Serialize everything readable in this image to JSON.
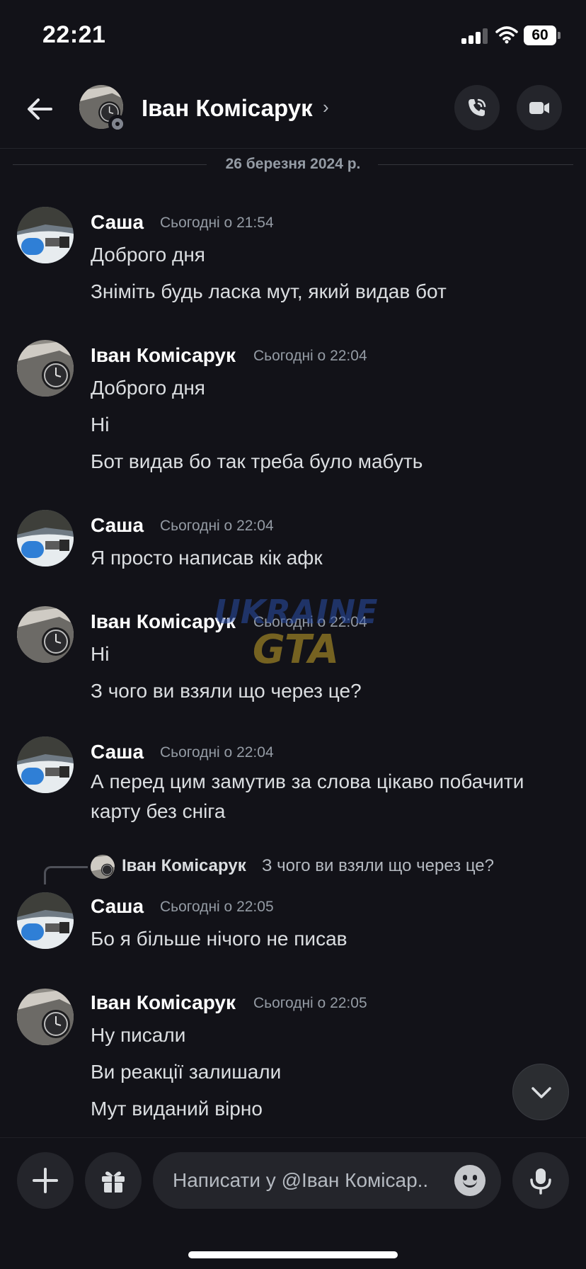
{
  "status_bar": {
    "time": "22:21",
    "battery": "60"
  },
  "header": {
    "contact_name": "Іван Комісарук",
    "chevron": "›"
  },
  "date_divider": "26 березня 2024 р.",
  "messages": [
    {
      "author": "Саша",
      "time": "Сьогодні о 21:54",
      "lines": [
        "Доброго дня",
        "Зніміть будь ласка мут, який видав бот"
      ]
    },
    {
      "author": "Іван Комісарук",
      "time": "Сьогодні о 22:04",
      "lines": [
        "Доброго дня",
        "Ні",
        "Бот видав бо так треба було мабуть"
      ]
    },
    {
      "author": "Саша",
      "time": "Сьогодні о 22:04",
      "lines": [
        "Я просто написав кік афк"
      ]
    },
    {
      "author": "Іван Комісарук",
      "time": "Сьогодні о 22:04",
      "lines": [
        "Ні",
        "З чого ви взяли що через це?"
      ]
    },
    {
      "author": "Саша",
      "time": "Сьогодні о 22:04",
      "lines": [
        "А перед цим замутив за слова цікаво побачити",
        "карту без сніга"
      ]
    },
    {
      "author": "Саша",
      "time": "Сьогодні о 22:05",
      "lines": [
        "Бо я більше нічого не писав"
      ]
    },
    {
      "author": "Іван Комісарук",
      "time": "Сьогодні о 22:05",
      "lines": [
        "Ну писали",
        "Ви реакції залишали",
        "Мут виданий вірно"
      ]
    }
  ],
  "reply_preview": {
    "author": "Іван Комісарук",
    "text": "З чого ви взяли що через це?"
  },
  "composer": {
    "placeholder": "Написати у @Іван Комісар.."
  },
  "watermark": {
    "line1": "UKRAINE",
    "line2": "GTA"
  },
  "colors": {
    "background": "#121218",
    "surface": "#24252b",
    "text": "#dbdee1",
    "muted": "#949ba4"
  }
}
